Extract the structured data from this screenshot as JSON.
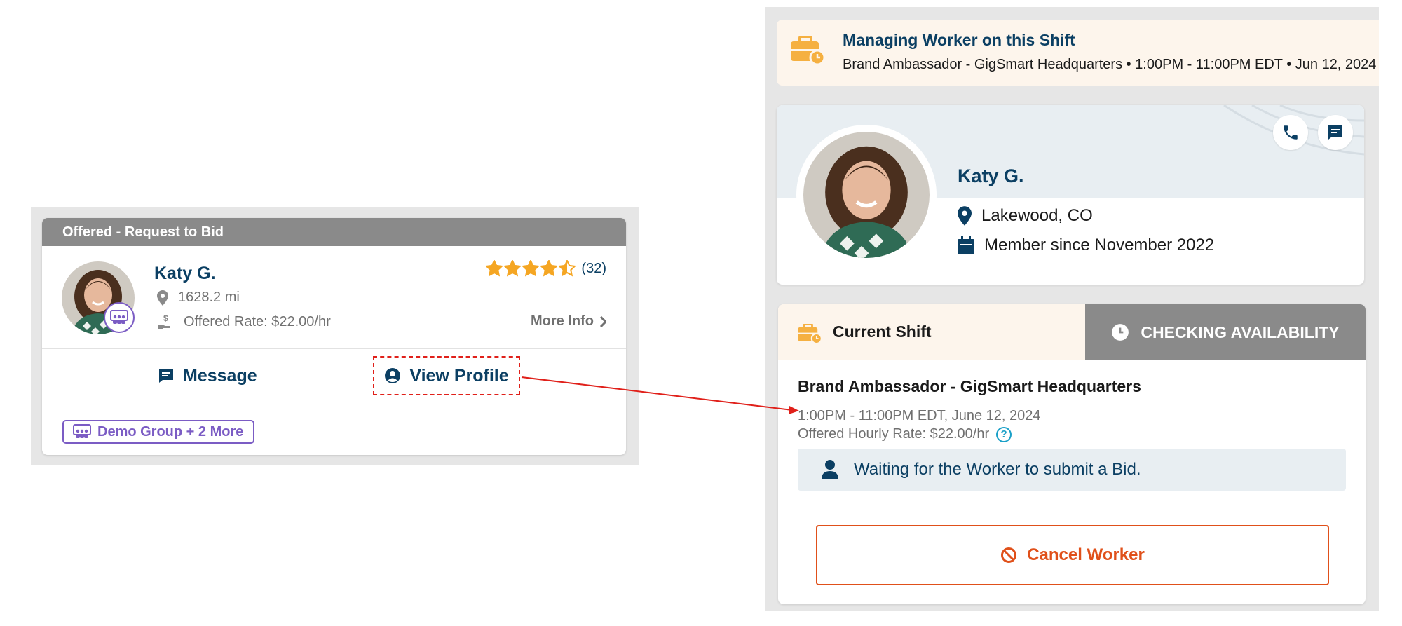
{
  "left_card": {
    "header": "Offered - Request to Bid",
    "worker_name": "Katy G.",
    "distance": "1628.2 mi",
    "offered_rate": "Offered Rate: $22.00/hr",
    "rating_count": "(32)",
    "rating": 4.5,
    "more_info": "More Info",
    "message_label": "Message",
    "view_profile_label": "View Profile",
    "group_tag": "Demo Group + 2 More"
  },
  "banner": {
    "title": "Managing Worker on this Shift",
    "subtitle": "Brand Ambassador - GigSmart Headquarters • 1:00PM - 11:00PM EDT • Jun 12, 2024"
  },
  "profile": {
    "name": "Katy G.",
    "location": "Lakewood, CO",
    "member_since": "Member since November 2022"
  },
  "shift": {
    "tab_label": "Current Shift",
    "status": "CHECKING AVAILABILITY",
    "title": "Brand Ambassador - GigSmart Headquarters",
    "time": "1:00PM - 11:00PM EDT, June 12, 2024",
    "rate": "Offered Hourly Rate: $22.00/hr",
    "waiting_message": "Waiting for the Worker to submit a Bid.",
    "cancel_label": "Cancel Worker"
  },
  "colors": {
    "navy": "#0b3f63",
    "purple": "#7b5cc4",
    "star": "#f5a623",
    "cancel": "#e0501a",
    "annotation_red": "#e0201a"
  }
}
